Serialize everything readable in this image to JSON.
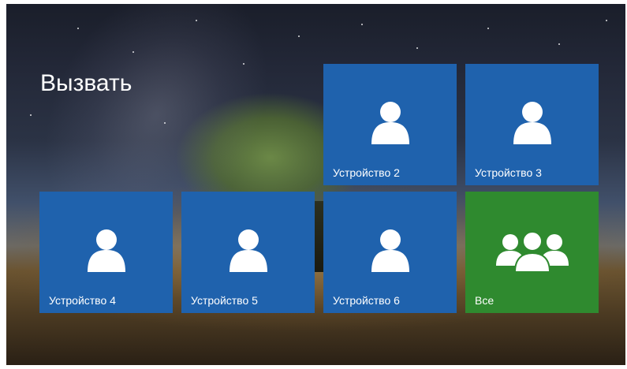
{
  "screen": {
    "title": "Вызвать"
  },
  "colors": {
    "tile_blue": "#1f62ad",
    "tile_green": "#2f8a2f"
  },
  "tiles": [
    {
      "label": "Устройство 2",
      "icon": "person-icon",
      "color": "#1f62ad"
    },
    {
      "label": "Устройство 3",
      "icon": "person-icon",
      "color": "#1f62ad"
    },
    {
      "label": "Устройство 4",
      "icon": "person-icon",
      "color": "#1f62ad"
    },
    {
      "label": "Устройство 5",
      "icon": "person-icon",
      "color": "#1f62ad"
    },
    {
      "label": "Устройство 6",
      "icon": "person-icon",
      "color": "#1f62ad"
    },
    {
      "label": "Все",
      "icon": "group-icon",
      "color": "#2f8a2f"
    }
  ]
}
